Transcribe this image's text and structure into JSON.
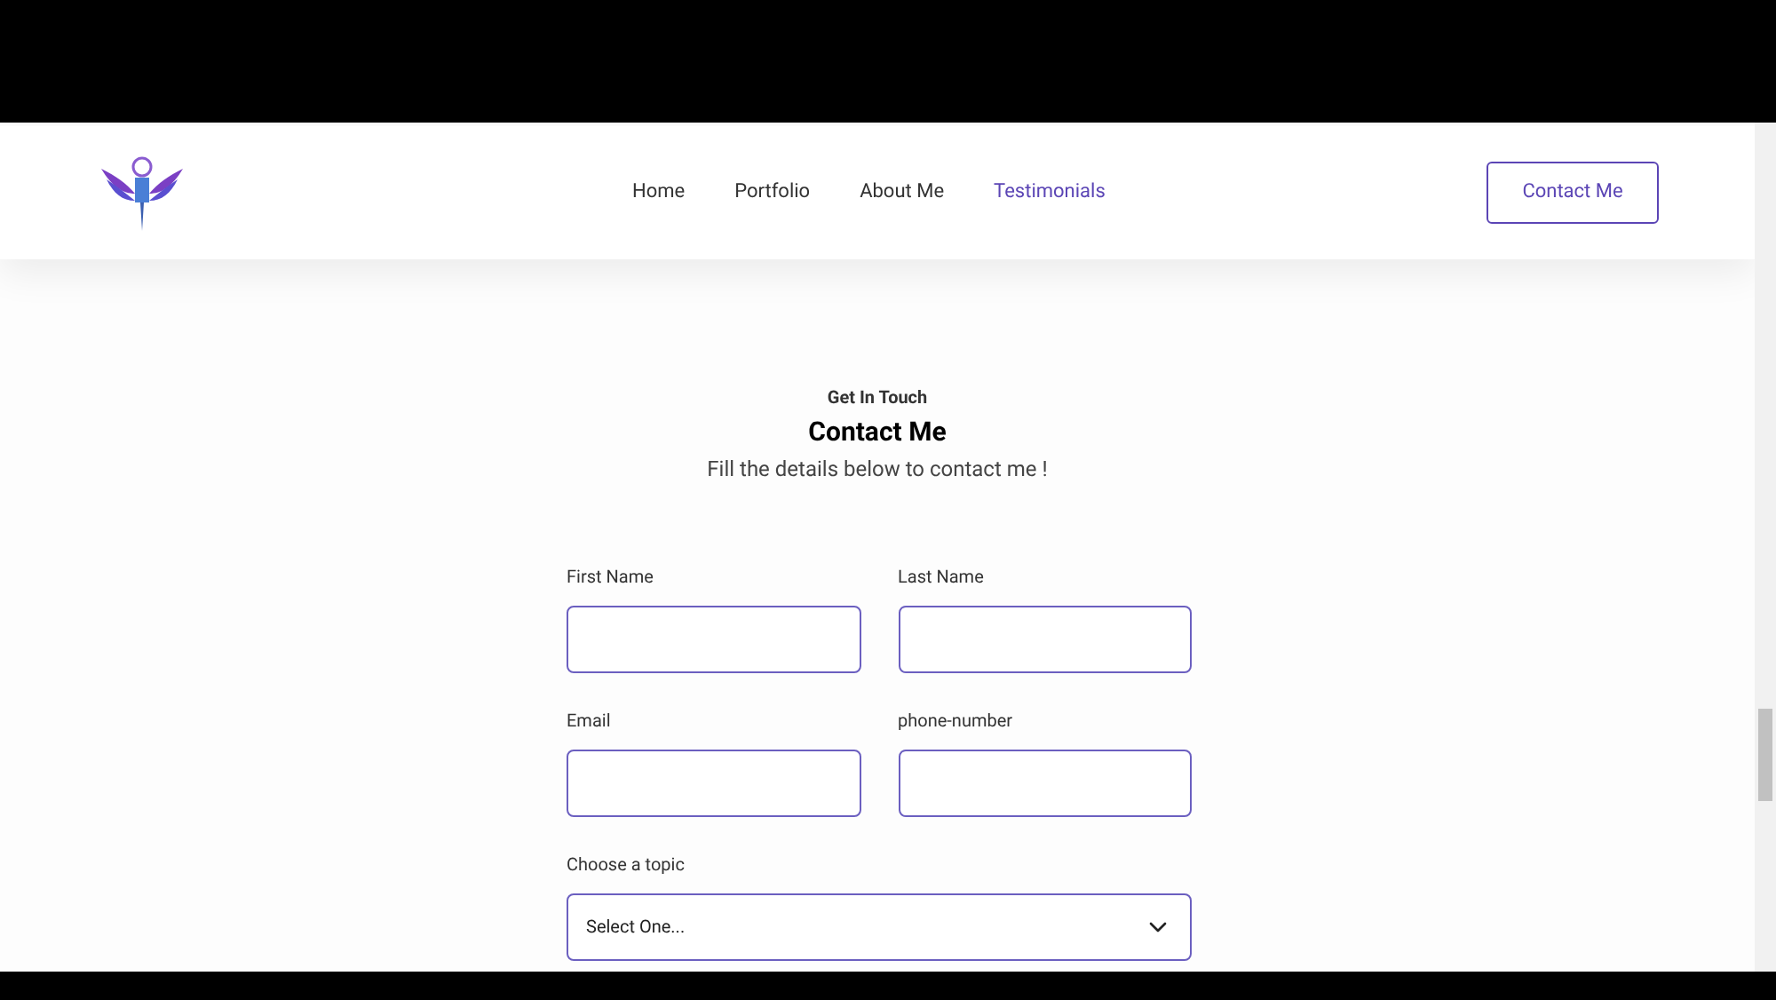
{
  "nav": {
    "items": [
      {
        "label": "Home",
        "selected": false
      },
      {
        "label": "Portfolio",
        "selected": false
      },
      {
        "label": "About Me",
        "selected": false
      },
      {
        "label": "Testimonials",
        "selected": true
      }
    ],
    "button": "Contact Me"
  },
  "section": {
    "eyebrow": "Get In Touch",
    "title": "Contact Me",
    "subtitle": "Fill the details below to contact me !"
  },
  "form": {
    "rows": [
      [
        {
          "label": "First Name"
        },
        {
          "label": "Last Name"
        }
      ],
      [
        {
          "label": "Email"
        },
        {
          "label": "phone-number"
        }
      ]
    ],
    "topic": {
      "label": "Choose a topic",
      "value": "Select One..."
    }
  }
}
